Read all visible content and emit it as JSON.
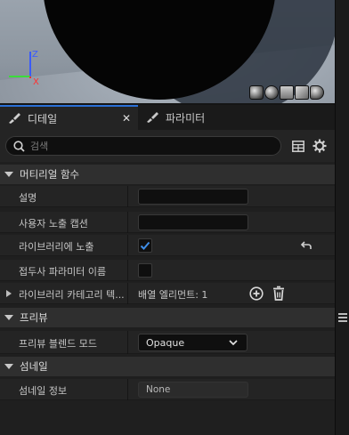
{
  "viewport": {
    "gizmo": {
      "z": "Z",
      "x": "X"
    },
    "preview_shapes": [
      "cylinder-icon",
      "sphere-icon",
      "plane-icon",
      "cube-icon",
      "teapot-icon"
    ]
  },
  "tabs": [
    {
      "label": "디테일",
      "icon": "brush-icon",
      "active": true
    },
    {
      "label": "파라미터",
      "icon": "brush-icon",
      "active": false
    }
  ],
  "search": {
    "placeholder": "검색"
  },
  "sections": {
    "material_function": {
      "title": "머티리얼 함수",
      "rows": {
        "description": {
          "label": "설명",
          "value": ""
        },
        "user_exposed_caption": {
          "label": "사용자 노출 캡션",
          "value": ""
        },
        "expose_to_library": {
          "label": "라이브러리에 노출",
          "checked": true
        },
        "prefix_param_names": {
          "label": "접두사 파라미터 이름",
          "checked": false
        },
        "library_categories": {
          "label": "라이브러리 카테고리 텍...",
          "value": "배열 엘리먼트: 1"
        }
      }
    },
    "preview": {
      "title": "프리뷰",
      "rows": {
        "blend_mode": {
          "label": "프리뷰 블렌드 모드",
          "value": "Opaque"
        }
      }
    },
    "thumbnail": {
      "title": "섬네일",
      "rows": {
        "thumbnail_info": {
          "label": "섬네일 정보",
          "value": "None"
        }
      }
    }
  },
  "colors": {
    "accent": "#2a6fd6",
    "check": "#3f8ee8"
  }
}
